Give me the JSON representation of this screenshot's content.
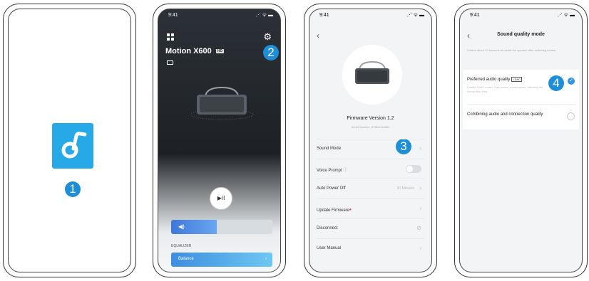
{
  "phone1": {
    "badge": "1"
  },
  "phone2": {
    "status_time": "9:41",
    "status_icons": "⋰ ᯤ ▬",
    "device_name": "Motion X600",
    "device_tag": "HD",
    "badge": "2",
    "play_icon": "▶II",
    "volume_level": 0.45,
    "equalizer_label": "EQUALIZER",
    "equalizer_value": "Balance",
    "equalizer_chevron": "›"
  },
  "phone3": {
    "status_time": "9:41",
    "status_icons": "⋰ ᯤ ▬",
    "back": "‹",
    "firmware": "Firmware Version 1.2",
    "serial": "Serial Number: 9F4B1C0A891",
    "badge": "3",
    "rows": [
      {
        "label": "Sound Mode",
        "value": "",
        "type": "link"
      },
      {
        "label": "Voice Prompt",
        "value": "",
        "type": "toggle"
      },
      {
        "label": "Auto Power Off",
        "value": "30 Minutes",
        "type": "link"
      },
      {
        "label": "Update Firmware",
        "value": "",
        "type": "link"
      },
      {
        "label": "Disconnect",
        "value": "",
        "type": "link"
      },
      {
        "label": "User Manual",
        "value": "",
        "type": "link"
      }
    ],
    "chevron": "›",
    "update_dot": "•"
  },
  "phone4": {
    "status_time": "9:41",
    "status_icons": "⋰ ᯤ ▬",
    "back": "‹",
    "title": "Sound quality mode",
    "description": "It takes about 10 seconds to restart the speaker after switching modes.",
    "option1_label": "Preferred audio quality",
    "option1_tag": "LDAC",
    "option1_sub": "Enable LDAC codec. High power consumption, affecting the connection time.",
    "option1_selected": true,
    "check": "✓",
    "option2_label": "Combining audio and connection quality",
    "option2_selected": false,
    "badge": "4"
  },
  "colors": {
    "accent": "#2e95e6",
    "badge": "#1d8fd8",
    "logo": "#27a9e8"
  }
}
